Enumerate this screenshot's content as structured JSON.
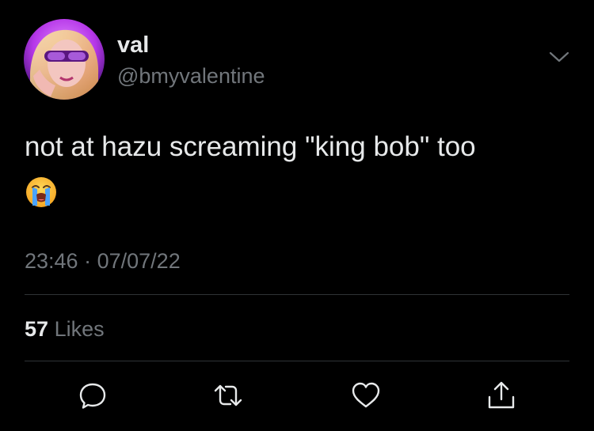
{
  "tweet": {
    "author": {
      "display_name": "val",
      "handle": "@bmyvalentine",
      "avatar": "profile-photo"
    },
    "text": "not at hazu screaming \"king bob\" too",
    "emoji": "loudly-crying-face",
    "time": "23:46",
    "separator": "·",
    "date": "07/07/22",
    "likes_count": "57",
    "likes_label": "Likes"
  },
  "icons": {
    "more": "chevron-down-icon",
    "reply": "reply-icon",
    "retweet": "retweet-icon",
    "like": "heart-icon",
    "share": "share-icon"
  },
  "colors": {
    "background": "#000000",
    "primary_text": "#e7e9ea",
    "secondary_text": "#71767b",
    "divider": "#2f3336"
  }
}
